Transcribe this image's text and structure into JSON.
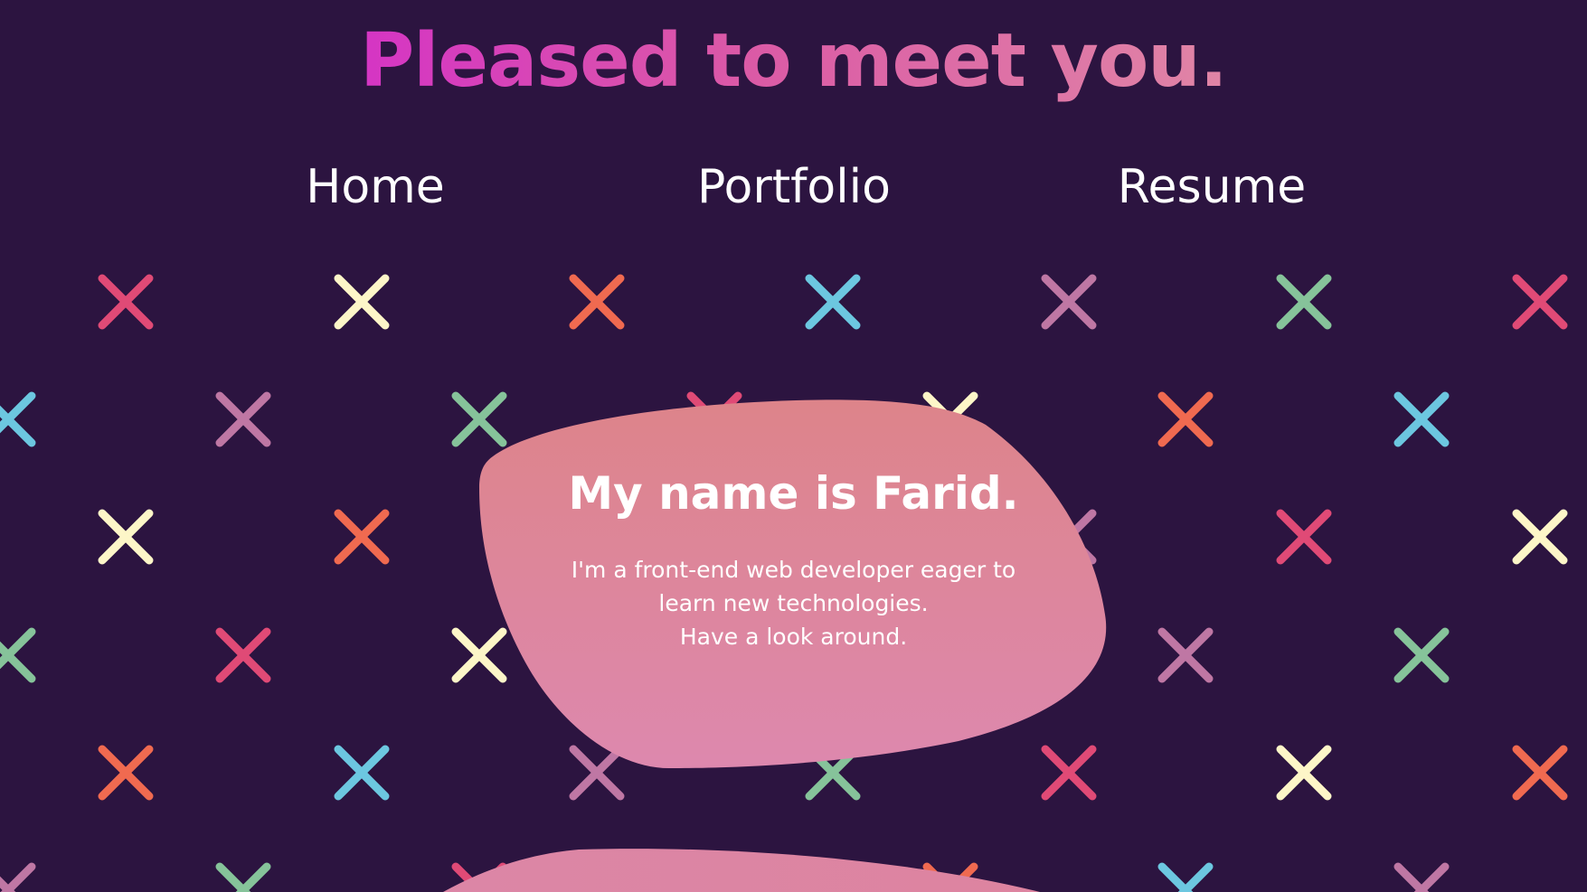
{
  "header": {
    "title": "Pleased to meet you."
  },
  "nav": {
    "items": [
      {
        "label": "Home"
      },
      {
        "label": "Portfolio"
      },
      {
        "label": "Resume"
      }
    ]
  },
  "intro": {
    "heading": "My name is Farid.",
    "lines": [
      "I'm a front-end web developer eager to",
      "learn new technologies.",
      "Have a look around."
    ]
  },
  "theme": {
    "background": "#2c1440",
    "title_gradient": [
      "#d535c4",
      "#e085a6"
    ],
    "card_gradient": [
      "#dd848a",
      "#dd88ae"
    ],
    "text": "#ffffff",
    "pattern_colors": {
      "pink": "#e04a76",
      "cream": "#fdf6c8",
      "orange": "#f06a50",
      "blue": "#6cc7e0",
      "mauve": "#bf77a4",
      "green": "#86c39a"
    }
  },
  "decor": {
    "pattern_icon": "cross-icon"
  }
}
